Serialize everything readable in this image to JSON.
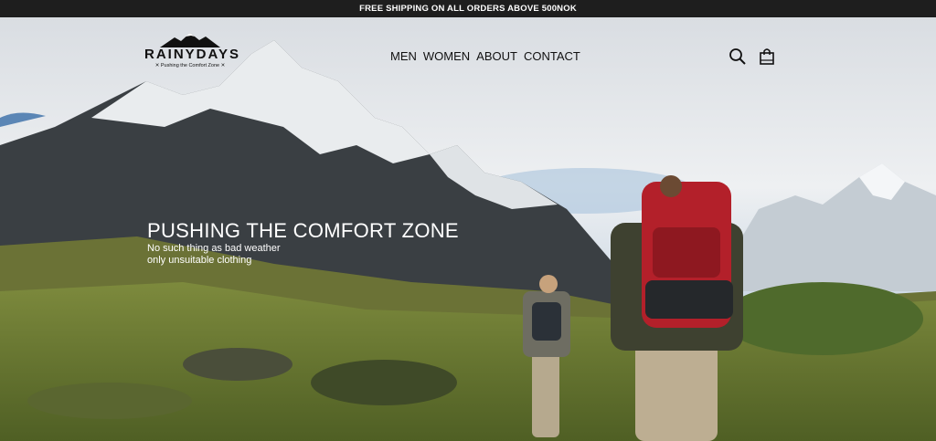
{
  "topbar": {
    "text": "FREE SHIPPING ON ALL ORDERS ABOVE 500NOK"
  },
  "logo": {
    "name": "RAINYDAYS",
    "tagline": "✕ Pushing the Comfort Zone ✕"
  },
  "nav": {
    "items": [
      "MEN",
      "WOMEN",
      "ABOUT",
      "CONTACT"
    ]
  },
  "icons": {
    "search": "search-icon",
    "cart": "shopping-bag-icon"
  },
  "hero": {
    "title": "PUSHING THE COMFORT ZONE",
    "line1": "No such thing as bad weather",
    "line2": "only unsuitable clothing"
  }
}
